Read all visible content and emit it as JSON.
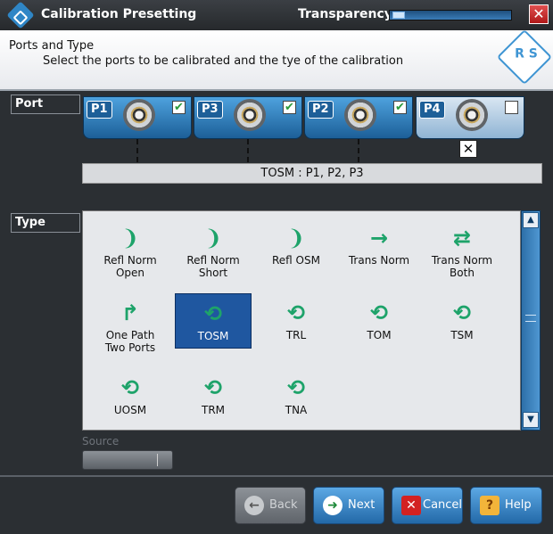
{
  "window": {
    "title": "Calibration Presetting",
    "transparency_label": "Transparency:",
    "close_glyph": "✕"
  },
  "header": {
    "title": "Ports and Type",
    "subtitle": "Select the ports to be calibrated and the tye of the calibration",
    "logo_text": "R S"
  },
  "ports_section": {
    "label": "Port",
    "ports": [
      {
        "name": "P1",
        "checked": true,
        "check_glyph": "✔"
      },
      {
        "name": "P3",
        "checked": true,
        "check_glyph": "✔"
      },
      {
        "name": "P2",
        "checked": true,
        "check_glyph": "✔"
      },
      {
        "name": "P4",
        "checked": false,
        "check_glyph": ""
      }
    ],
    "remove_glyph": "✕",
    "summary": "TOSM : P1, P2, P3"
  },
  "type_section": {
    "label": "Type",
    "items": [
      {
        "line1": "Refl Norm",
        "line2": "Open",
        "icon": "reflect-open-icon",
        "glyph": "❩",
        "selected": false
      },
      {
        "line1": "Refl Norm",
        "line2": "Short",
        "icon": "reflect-short-icon",
        "glyph": "❩",
        "selected": false
      },
      {
        "line1": "Refl OSM",
        "line2": "",
        "icon": "reflect-osm-icon",
        "glyph": "❩",
        "selected": false
      },
      {
        "line1": "Trans Norm",
        "line2": "",
        "icon": "trans-norm-icon",
        "glyph": "→",
        "selected": false
      },
      {
        "line1": "Trans Norm",
        "line2": "Both",
        "icon": "trans-norm-both-icon",
        "glyph": "⇄",
        "selected": false
      },
      {
        "line1": "One Path",
        "line2": "Two Ports",
        "icon": "one-path-two-ports-icon",
        "glyph": "↱",
        "selected": false
      },
      {
        "line1": "TOSM",
        "line2": "",
        "icon": "tosm-icon",
        "glyph": "⟲",
        "selected": true
      },
      {
        "line1": "TRL",
        "line2": "",
        "icon": "trl-icon",
        "glyph": "⟲",
        "selected": false
      },
      {
        "line1": "TOM",
        "line2": "",
        "icon": "tom-icon",
        "glyph": "⟲",
        "selected": false
      },
      {
        "line1": "TSM",
        "line2": "",
        "icon": "tsm-icon",
        "glyph": "⟲",
        "selected": false
      },
      {
        "line1": "UOSM",
        "line2": "",
        "icon": "uosm-icon",
        "glyph": "⟲",
        "selected": false
      },
      {
        "line1": "TRM",
        "line2": "",
        "icon": "trm-icon",
        "glyph": "⟲",
        "selected": false
      },
      {
        "line1": "TNA",
        "line2": "",
        "icon": "tna-icon",
        "glyph": "⟲",
        "selected": false
      }
    ],
    "scroll_up_glyph": "▲",
    "scroll_down_glyph": "▼"
  },
  "source": {
    "label": "Source",
    "value": ""
  },
  "footer": {
    "back_label": "Back",
    "back_glyph": "←",
    "next_label": "Next",
    "next_glyph": "➜",
    "cancel_label": "Cancel",
    "cancel_glyph": "✕",
    "help_label": "Help",
    "help_glyph": "?"
  },
  "colors": {
    "accent": "#2f86c6",
    "selected": "#1f57a0",
    "icon_green": "#1ea36a"
  }
}
